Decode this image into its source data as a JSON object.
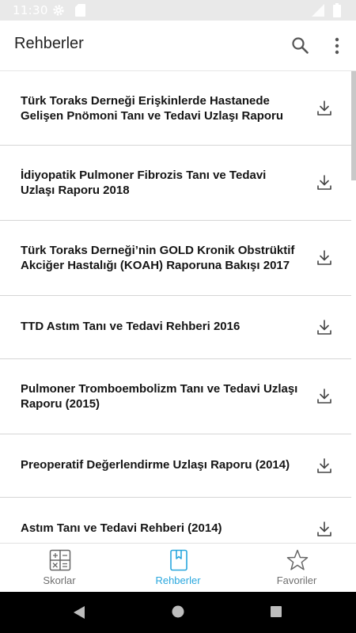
{
  "status_bar": {
    "time": "11:30",
    "icons": [
      "gear-icon",
      "sd-card-icon",
      "signal-icon",
      "battery-icon"
    ]
  },
  "app_bar": {
    "title": "Rehberler",
    "actions": [
      "search-icon",
      "more-vert-icon"
    ]
  },
  "guidelines": {
    "items": [
      {
        "title": "Türk Toraks Derneği Erişkinlerde Hastanede Gelişen Pnömoni Tanı ve Tedavi Uzlaşı Raporu"
      },
      {
        "title": "İdiyopatik Pulmoner Fibrozis Tanı ve Tedavi Uzlaşı Raporu 2018"
      },
      {
        "title": "Türk Toraks Derneği’nin GOLD Kronik Obstrüktif Akciğer Hastalığı (KOAH) Raporuna Bakışı 2017"
      },
      {
        "title": "TTD Astım Tanı ve Tedavi Rehberi 2016"
      },
      {
        "title": "Pulmoner Tromboembolizm Tanı ve Tedavi Uzlaşı Raporu (2015)"
      },
      {
        "title": "Preoperatif Değerlendirme Uzlaşı Raporu (2014)"
      },
      {
        "title": "Astım Tanı ve Tedavi Rehberi (2014)"
      }
    ],
    "item_icon": "download-icon"
  },
  "bottom_nav": {
    "tabs": [
      {
        "label": "Skorlar",
        "icon": "calculator-icon"
      },
      {
        "label": "Rehberler",
        "icon": "book-icon"
      },
      {
        "label": "Favoriler",
        "icon": "star-icon"
      }
    ],
    "active_tab": "Rehberler"
  },
  "colors": {
    "accent": "#29a7de",
    "status_bar": "#e9e9e9",
    "divider": "#d6d6d6",
    "inactive_tab": "#6f6f6f"
  }
}
